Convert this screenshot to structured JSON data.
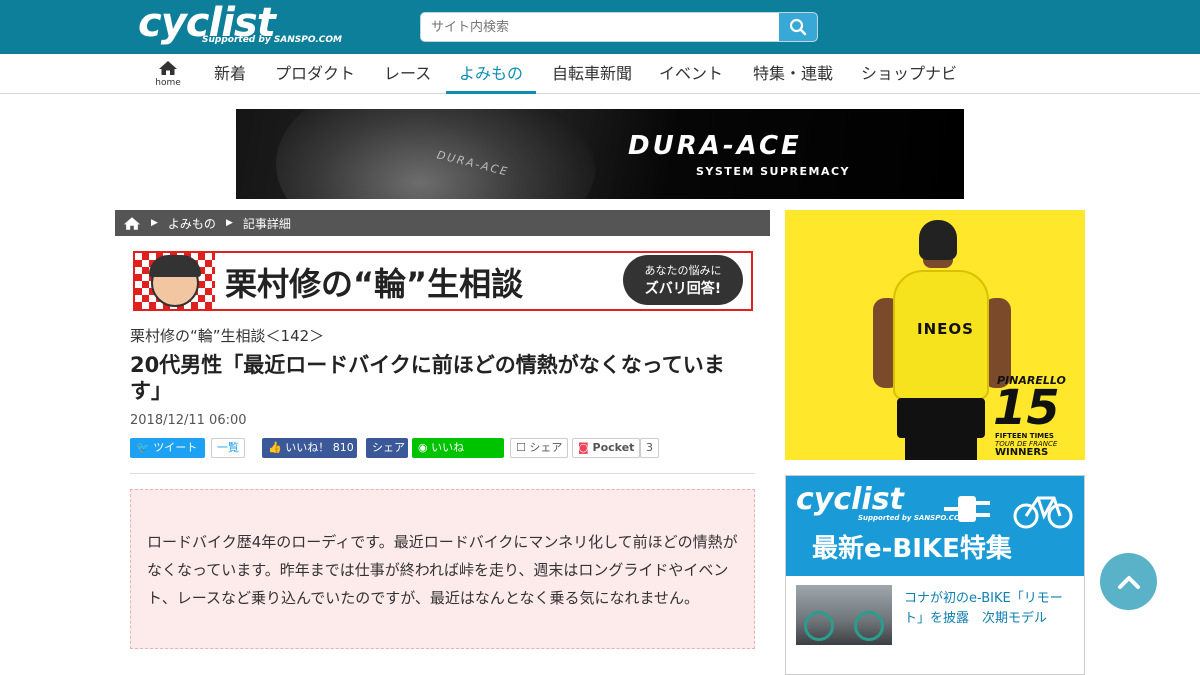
{
  "header": {
    "logo_text": "cyclist",
    "logo_sub": "Supported by SANSPO.COM",
    "search_placeholder": "サイト内検索",
    "search_icon": "search-icon"
  },
  "nav": {
    "home_label": "home",
    "home_icon": "home-icon",
    "items": [
      {
        "label": "新着"
      },
      {
        "label": "プロダクト"
      },
      {
        "label": "レース"
      },
      {
        "label": "よみもの",
        "active": true
      },
      {
        "label": "自転車新聞"
      },
      {
        "label": "イベント"
      },
      {
        "label": "特集・連載"
      },
      {
        "label": "ショップナビ"
      }
    ],
    "active_color": "#0e8fb2"
  },
  "banner_ad": {
    "engraving": "DURA-ACE",
    "brand": "DURA-ACE",
    "tagline": "SYSTEM SUPREMACY"
  },
  "breadcrumb": {
    "home_icon": "home-icon",
    "items": [
      "よみもの",
      "記事詳細"
    ]
  },
  "series_banner": {
    "title": "栗村修の“輪”生相談",
    "bubble_line1": "あなたの悩みに",
    "bubble_line2": "ズバリ回答!"
  },
  "article": {
    "subtitle": "栗村修の“輪”生相談＜142＞",
    "title": "20代男性「最近ロードバイクに前ほどの情熱がなくなっています」",
    "date": "2018/12/11 06:00",
    "question": "ロードバイク歴4年のローディです。最近ロードバイクにマンネリ化して前ほどの情熱がなくなっています。昨年までは仕事が終われば峠を走り、週末はロングライドやイベント、レースなど乗り込んでいたのですが、最近はなんとなく乗る気になれません。"
  },
  "social": {
    "tweet": "ツイート",
    "list": "一覧",
    "like": "いいね！",
    "like_count": "810",
    "share_fb": "シェア",
    "line": "いいね",
    "share": "シェア",
    "pocket": "Pocket",
    "pocket_count": "3",
    "colors": {
      "twitter": "#1da1f2",
      "facebook": "#3b5998",
      "line": "#00c300",
      "pocket": "#ef4056"
    }
  },
  "sidebar": {
    "ad1": {
      "team_text": "INEOS",
      "brand": "PINARELLO",
      "number": "15",
      "line1": "FIFTEEN TIMES",
      "line2": "TOUR DE FRANCE",
      "line3": "WINNERS"
    },
    "ad2": {
      "logo": "cyclist",
      "logo_sub": "Supported by SANSPO.COM",
      "title": "最新e-BIKE特集",
      "article_text": "コナが初のe-BIKE「リモート」を披露　次期モデル"
    }
  },
  "pagetop_icon": "chevron-up-icon"
}
